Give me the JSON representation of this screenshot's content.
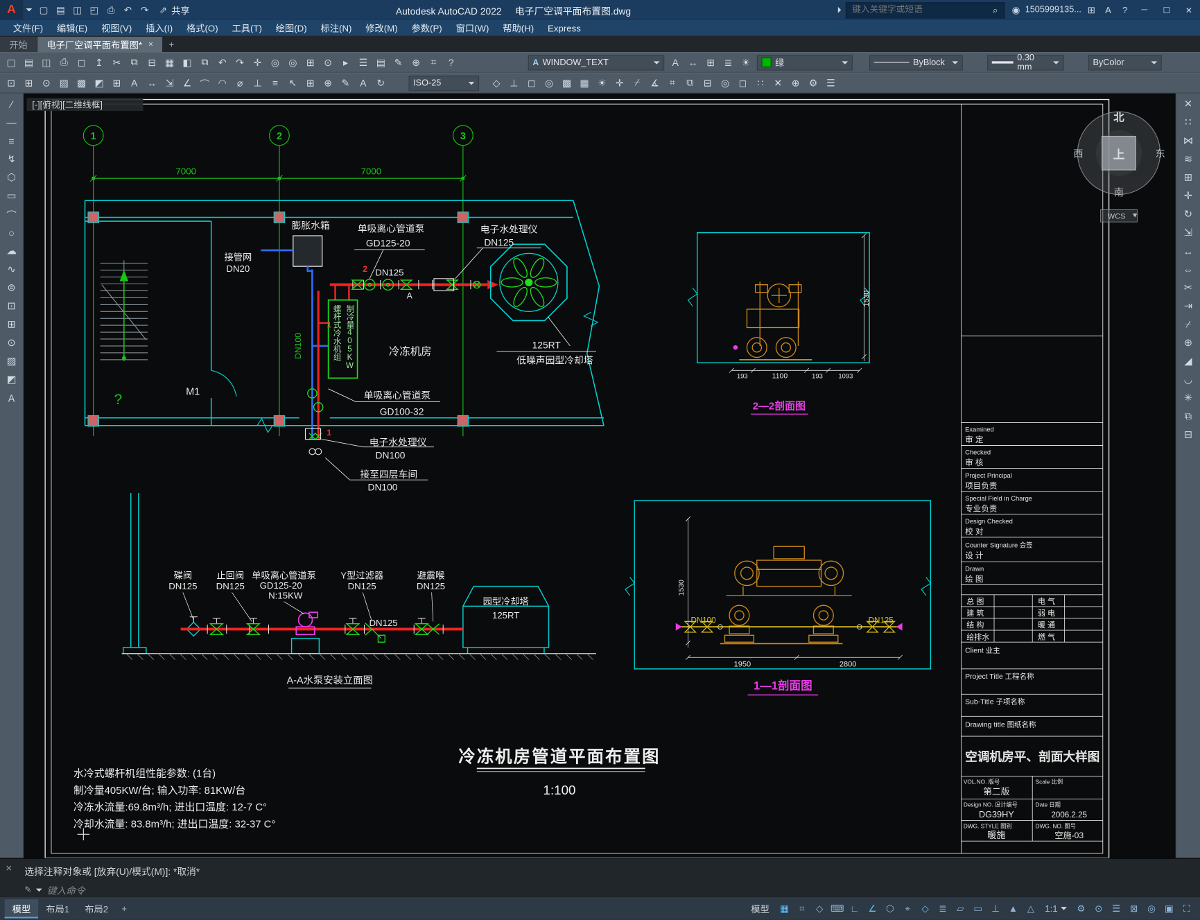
{
  "titlebar": {
    "logo": "A",
    "app": "Autodesk AutoCAD 2022",
    "doc": "电子厂空调平面布置图.dwg",
    "share": "共享",
    "search_placeholder": "键入关键字或短语",
    "user": "1505999135...",
    "min": "─",
    "max": "☐",
    "close": "✕"
  },
  "menubar": {
    "items": [
      "文件(F)",
      "编辑(E)",
      "视图(V)",
      "插入(I)",
      "格式(O)",
      "工具(T)",
      "绘图(D)",
      "标注(N)",
      "修改(M)",
      "参数(P)",
      "窗口(W)",
      "帮助(H)",
      "Express"
    ]
  },
  "filetabs": {
    "start": "开始",
    "active": "电子厂空调平面布置图*",
    "close": "×",
    "add": "+"
  },
  "toolbars": {
    "text_style": "WINDOW_TEXT",
    "layer": "绿",
    "linetype": "ByBlock",
    "lineweight": "0.30 mm",
    "plot_style": "ByColor",
    "dim_style": "ISO-25"
  },
  "viewport": {
    "controls": "[-][俯视][二维线框]"
  },
  "compass": {
    "n": "北",
    "e": "东",
    "s": "南",
    "w": "西",
    "up": "上",
    "wcs": "WCS"
  },
  "plan": {
    "axes": [
      "1",
      "2",
      "3"
    ],
    "dim1": "7000",
    "dim2": "7000",
    "tank": "膨胀水箱",
    "pipe_net1": "接管网",
    "pipe_net2": "DN20",
    "pump_top1": "单吸离心管道泵",
    "pump_top2": "GD125-20",
    "treater_top1": "电子水处理仪",
    "treater_top2": "DN125",
    "dn125": "DN125",
    "flow_a": "A",
    "chiller1": "螺杆式冷水机组",
    "chiller2": "制冷量405KW",
    "room": "冷冻机房",
    "tower1": "125RT",
    "tower2": "低噪声园型冷却塔",
    "door": "M1",
    "question": "?",
    "dn100_riser": "DN100",
    "pump_bot1": "单吸离心管道泵",
    "pump_bot2": "GD100-32",
    "treater_bot1": "电子水处理仪",
    "treater_bot2": "DN100",
    "to_floor1": "接至四层车间",
    "to_floor2": "DN100",
    "mark1": "1",
    "mark2": "2"
  },
  "elevation": {
    "lbl1a": "碟阀",
    "lbl1b": "DN125",
    "lbl2a": "止回阀",
    "lbl2b": "DN125",
    "lbl3a": "单吸离心管道泵",
    "lbl3b": "GD125-20",
    "lbl3c": "N:15KW",
    "lbl4a": "Y型过滤器",
    "lbl4b": "DN125",
    "lbl5a": "避震喉",
    "lbl5b": "DN125",
    "tower1": "园型冷却塔",
    "tower2": "125RT",
    "dn125": "DN125",
    "caption": "A-A水泵安装立面图"
  },
  "section22": {
    "dim_h": "1530",
    "d1": "193",
    "d2": "1100",
    "d3": "193",
    "d4": "1093",
    "caption": "2—2剖面图"
  },
  "section11": {
    "dim_h": "1530",
    "d1": "1950",
    "d2": "2800",
    "dn100": "DN100",
    "dn125": "DN125",
    "caption": "1—1剖面图"
  },
  "sheet": {
    "title": "冷冻机房管道平面布置图",
    "scale": "1:100"
  },
  "specs": {
    "l1": "水冷式螺杆机组性能参数: (1台)",
    "l2": "制冷量405KW/台; 输入功率: 81KW/台",
    "l3": "冷冻水流量:69.8m³/h; 进出口温度: 12-7 C°",
    "l4": "冷却水流量: 83.8m³/h; 进出口温度: 32-37 C°"
  },
  "titleblock": {
    "rows": [
      {
        "en": "Examined",
        "zh": "审 定"
      },
      {
        "en": "Checked",
        "zh": "审 核"
      },
      {
        "en": "Project Principal",
        "zh": "项目负责"
      },
      {
        "en": "Special Field in Charge",
        "zh": "专业负责"
      },
      {
        "en": "Design Checked",
        "zh": "校 对"
      },
      {
        "en": "Counter Signature 会签",
        "zh": "设 计"
      },
      {
        "en": "Drawn",
        "zh": "绘 图"
      }
    ],
    "disc_l": [
      "总 图",
      "建 筑",
      "结 构",
      "给排水"
    ],
    "disc_r": [
      "电 气",
      "弱 电",
      "暖 通",
      "燃 气"
    ],
    "client": "Client 业主",
    "project": "Project Title 工程名称",
    "sub": "Sub-Title 子项名称",
    "drawing": "Drawing title 图纸名称",
    "name": "空调机房平、剖面大样图",
    "vol_l": "VOL.NO. 版号",
    "vol_v": "第二版",
    "scale_l": "Scale 比例",
    "design_l": "Design NO. 设计编号",
    "design_v": "DG39HY",
    "date_l": "Date 日期",
    "date_v": "2006.2.25",
    "style_l": "DWG. STYLE 图别",
    "style_v": "暖施",
    "no_l": "DWG. NO. 图号",
    "no_v": "空施-03"
  },
  "commandline": {
    "history": "选择注释对象或 [放弃(U)/模式(M)]: *取消*",
    "prompt": "键入命令"
  },
  "statusbar": {
    "tabs": [
      "模型",
      "布局1",
      "布局2"
    ],
    "add": "+",
    "model": "模型",
    "scale": "1:1"
  },
  "iconsets": {
    "qat": [
      {
        "n": "qat-new-icon",
        "g": "▢"
      },
      {
        "n": "qat-open-icon",
        "g": "▤"
      },
      {
        "n": "qat-save-icon",
        "g": "◫"
      },
      {
        "n": "qat-saveas-icon",
        "g": "◰"
      },
      {
        "n": "qat-plot-icon",
        "g": "⎙"
      },
      {
        "n": "qat-undo-icon",
        "g": "↶"
      },
      {
        "n": "qat-redo-icon",
        "g": "↷"
      }
    ],
    "row1": [
      {
        "n": "qnew-icon",
        "g": "▢"
      },
      {
        "n": "open-icon",
        "g": "▤"
      },
      {
        "n": "save-icon",
        "g": "◫"
      },
      {
        "n": "plot-icon",
        "g": "⎙"
      },
      {
        "n": "plot-preview-icon",
        "g": "◻"
      },
      {
        "n": "publish-icon",
        "g": "↥"
      },
      {
        "n": "cut-icon",
        "g": "✂"
      },
      {
        "n": "copy-icon",
        "g": "⧉"
      },
      {
        "n": "paste-icon",
        "g": "⊟"
      },
      {
        "n": "match-properties-icon",
        "g": "▦"
      },
      {
        "n": "block-editor-icon",
        "g": "◧"
      },
      {
        "n": "xref-icon",
        "g": "⧉"
      },
      {
        "n": "undo-icon",
        "g": "↶"
      },
      {
        "n": "redo-icon",
        "g": "↷"
      },
      {
        "n": "pan-icon",
        "g": "✛"
      },
      {
        "n": "steering-wheel-icon",
        "g": "◎"
      },
      {
        "n": "zoom-realtime-icon",
        "g": "◎"
      },
      {
        "n": "zoom-window-icon",
        "g": "⊞"
      },
      {
        "n": "zoom-previous-icon",
        "g": "⊙"
      },
      {
        "n": "show-motion-icon",
        "g": "▸"
      },
      {
        "n": "properties-icon",
        "g": "☰"
      },
      {
        "n": "sheet-set-icon",
        "g": "▤"
      },
      {
        "n": "markup-icon",
        "g": "✎"
      },
      {
        "n": "field-icon",
        "g": "⊕"
      },
      {
        "n": "calculator-icon",
        "g": "⌗"
      },
      {
        "n": "help-icon",
        "g": "?"
      }
    ],
    "row1b": [
      {
        "n": "text-style-icon",
        "g": "A"
      },
      {
        "n": "dim-style-icon",
        "g": "↔"
      },
      {
        "n": "table-style-icon",
        "g": "⊞"
      }
    ],
    "row1c": [
      {
        "n": "layer-properties-icon",
        "g": "≣"
      },
      {
        "n": "layer-states-icon",
        "g": "☀"
      }
    ],
    "row2a": [
      {
        "n": "insert-block-icon",
        "g": "⊡"
      },
      {
        "n": "make-block-icon",
        "g": "⊞"
      },
      {
        "n": "point-icon",
        "g": "⊙"
      },
      {
        "n": "hatch-icon",
        "g": "▨"
      },
      {
        "n": "gradient-icon",
        "g": "▩"
      },
      {
        "n": "region-icon",
        "g": "◩"
      },
      {
        "n": "table-icon",
        "g": "⊞"
      },
      {
        "n": "mtext-icon",
        "g": "A"
      },
      {
        "n": "dim-linear-icon",
        "g": "↔"
      },
      {
        "n": "dim-aligned-icon",
        "g": "⇲"
      },
      {
        "n": "dim-angular-icon",
        "g": "∠"
      },
      {
        "n": "dim-arc-icon",
        "g": "⌒"
      },
      {
        "n": "dim-radius-icon",
        "g": "◠"
      },
      {
        "n": "dim-diameter-icon",
        "g": "⌀"
      },
      {
        "n": "dim-ordinate-icon",
        "g": "⊥"
      },
      {
        "n": "dim-continue-icon",
        "g": "≡"
      },
      {
        "n": "quick-leader-icon",
        "g": "↖"
      },
      {
        "n": "tolerance-icon",
        "g": "⊞"
      },
      {
        "n": "center-mark-icon",
        "g": "⊕"
      },
      {
        "n": "dim-edit-icon",
        "g": "✎"
      },
      {
        "n": "dim-text-edit-icon",
        "g": "A"
      },
      {
        "n": "dim-update-icon",
        "g": "↻"
      }
    ],
    "row2b": [
      {
        "n": "osnap-settings-icon",
        "g": "◇"
      },
      {
        "n": "ucs-icon",
        "g": "⊥"
      },
      {
        "n": "named-views-icon",
        "g": "◻"
      },
      {
        "n": "orbit-icon",
        "g": "◎"
      },
      {
        "n": "render-icon",
        "g": "▩"
      },
      {
        "n": "materials-icon",
        "g": "▦"
      },
      {
        "n": "lights-icon",
        "g": "☀"
      },
      {
        "n": "walk-icon",
        "g": "✛"
      },
      {
        "n": "section-plane-icon",
        "g": "⌿"
      },
      {
        "n": "measure-icon",
        "g": "∡"
      },
      {
        "n": "quickcalc-icon",
        "g": "⌗"
      },
      {
        "n": "group-icon",
        "g": "⧉"
      },
      {
        "n": "ungroup-icon",
        "g": "⊟"
      },
      {
        "n": "isolate-icon",
        "g": "◎"
      },
      {
        "n": "hide-icon",
        "g": "◻"
      },
      {
        "n": "select-similar-icon",
        "g": "∷"
      },
      {
        "n": "purge-icon",
        "g": "✕"
      },
      {
        "n": "audit-icon",
        "g": "⊕"
      },
      {
        "n": "options-icon",
        "g": "⚙"
      },
      {
        "n": "customize-icon",
        "g": "☰"
      }
    ],
    "draw": [
      {
        "n": "line-icon",
        "g": "∕"
      },
      {
        "n": "construction-line-icon",
        "g": "—"
      },
      {
        "n": "multiline-icon",
        "g": "≡"
      },
      {
        "n": "polyline-icon",
        "g": "↯"
      },
      {
        "n": "polygon-icon",
        "g": "⬡"
      },
      {
        "n": "rectangle-icon",
        "g": "▭"
      },
      {
        "n": "arc-icon",
        "g": "⌒"
      },
      {
        "n": "circle-icon",
        "g": "○"
      },
      {
        "n": "revcloud-icon",
        "g": "☁"
      },
      {
        "n": "spline-icon",
        "g": "∿"
      },
      {
        "n": "ellipse-icon",
        "g": "⊜"
      },
      {
        "n": "insert-block-icon",
        "g": "⊡"
      },
      {
        "n": "make-block-icon",
        "g": "⊞"
      },
      {
        "n": "point-icon",
        "g": "⊙"
      },
      {
        "n": "hatch-icon",
        "g": "▨"
      },
      {
        "n": "region-icon",
        "g": "◩"
      },
      {
        "n": "mtext-icon",
        "g": "A"
      }
    ],
    "modify": [
      {
        "n": "erase-icon",
        "g": "✕"
      },
      {
        "n": "copy-icon",
        "g": "∷"
      },
      {
        "n": "mirror-icon",
        "g": "⋈"
      },
      {
        "n": "offset-icon",
        "g": "≋"
      },
      {
        "n": "array-icon",
        "g": "⊞"
      },
      {
        "n": "move-icon",
        "g": "✛"
      },
      {
        "n": "rotate-icon",
        "g": "↻"
      },
      {
        "n": "scale-icon",
        "g": "⇲"
      },
      {
        "n": "stretch-icon",
        "g": "↔"
      },
      {
        "n": "lengthen-icon",
        "g": "⇔"
      },
      {
        "n": "trim-icon",
        "g": "✂"
      },
      {
        "n": "extend-icon",
        "g": "⇥"
      },
      {
        "n": "break-icon",
        "g": "⌿"
      },
      {
        "n": "join-icon",
        "g": "⊕"
      },
      {
        "n": "chamfer-icon",
        "g": "◢"
      },
      {
        "n": "fillet-icon",
        "g": "◡"
      },
      {
        "n": "explode-icon",
        "g": "✳"
      },
      {
        "n": "group-icon",
        "g": "⧉"
      },
      {
        "n": "ungroup-icon",
        "g": "⊟"
      }
    ],
    "status1": [
      {
        "n": "grid-icon",
        "g": "▦",
        "on": true
      },
      {
        "n": "snap-icon",
        "g": "⌗"
      },
      {
        "n": "infer-icon",
        "g": "◇"
      },
      {
        "n": "dynamic-input-icon",
        "g": "⌨"
      },
      {
        "n": "ortho-icon",
        "g": "∟"
      },
      {
        "n": "polar-icon",
        "g": "∠",
        "on": true
      },
      {
        "n": "isodraft-icon",
        "g": "⬡"
      },
      {
        "n": "otrack-icon",
        "g": "⌖"
      },
      {
        "n": "osnap-icon",
        "g": "◇",
        "on": true
      },
      {
        "n": "lineweight-icon",
        "g": "≣"
      },
      {
        "n": "transparency-icon",
        "g": "▱"
      },
      {
        "n": "selection-cycling-icon",
        "g": "▭"
      },
      {
        "n": "dynamic-ucs-icon",
        "g": "⊥"
      },
      {
        "n": "annotation-visibility-icon",
        "g": "▲"
      },
      {
        "n": "autoscale-icon",
        "g": "△"
      }
    ],
    "status2": [
      {
        "n": "workspace-gear-icon",
        "g": "⚙"
      },
      {
        "n": "annotation-monitor-icon",
        "g": "⊙"
      },
      {
        "n": "quick-properties-icon",
        "g": "☰"
      },
      {
        "n": "lock-ui-icon",
        "g": "⊠"
      },
      {
        "n": "object-isolate-icon",
        "g": "◎"
      },
      {
        "n": "graphics-performance-icon",
        "g": "▣"
      },
      {
        "n": "clean-screen-icon",
        "g": "⛶"
      }
    ],
    "misc": {
      "share": "⇗",
      "search": "⌕",
      "user_glyph": "◉",
      "cart": "⊞",
      "alogo_small": "A",
      "help": "?",
      "text_a": "A",
      "cmd_edit": "✎",
      "cmd_close": "✕"
    }
  }
}
